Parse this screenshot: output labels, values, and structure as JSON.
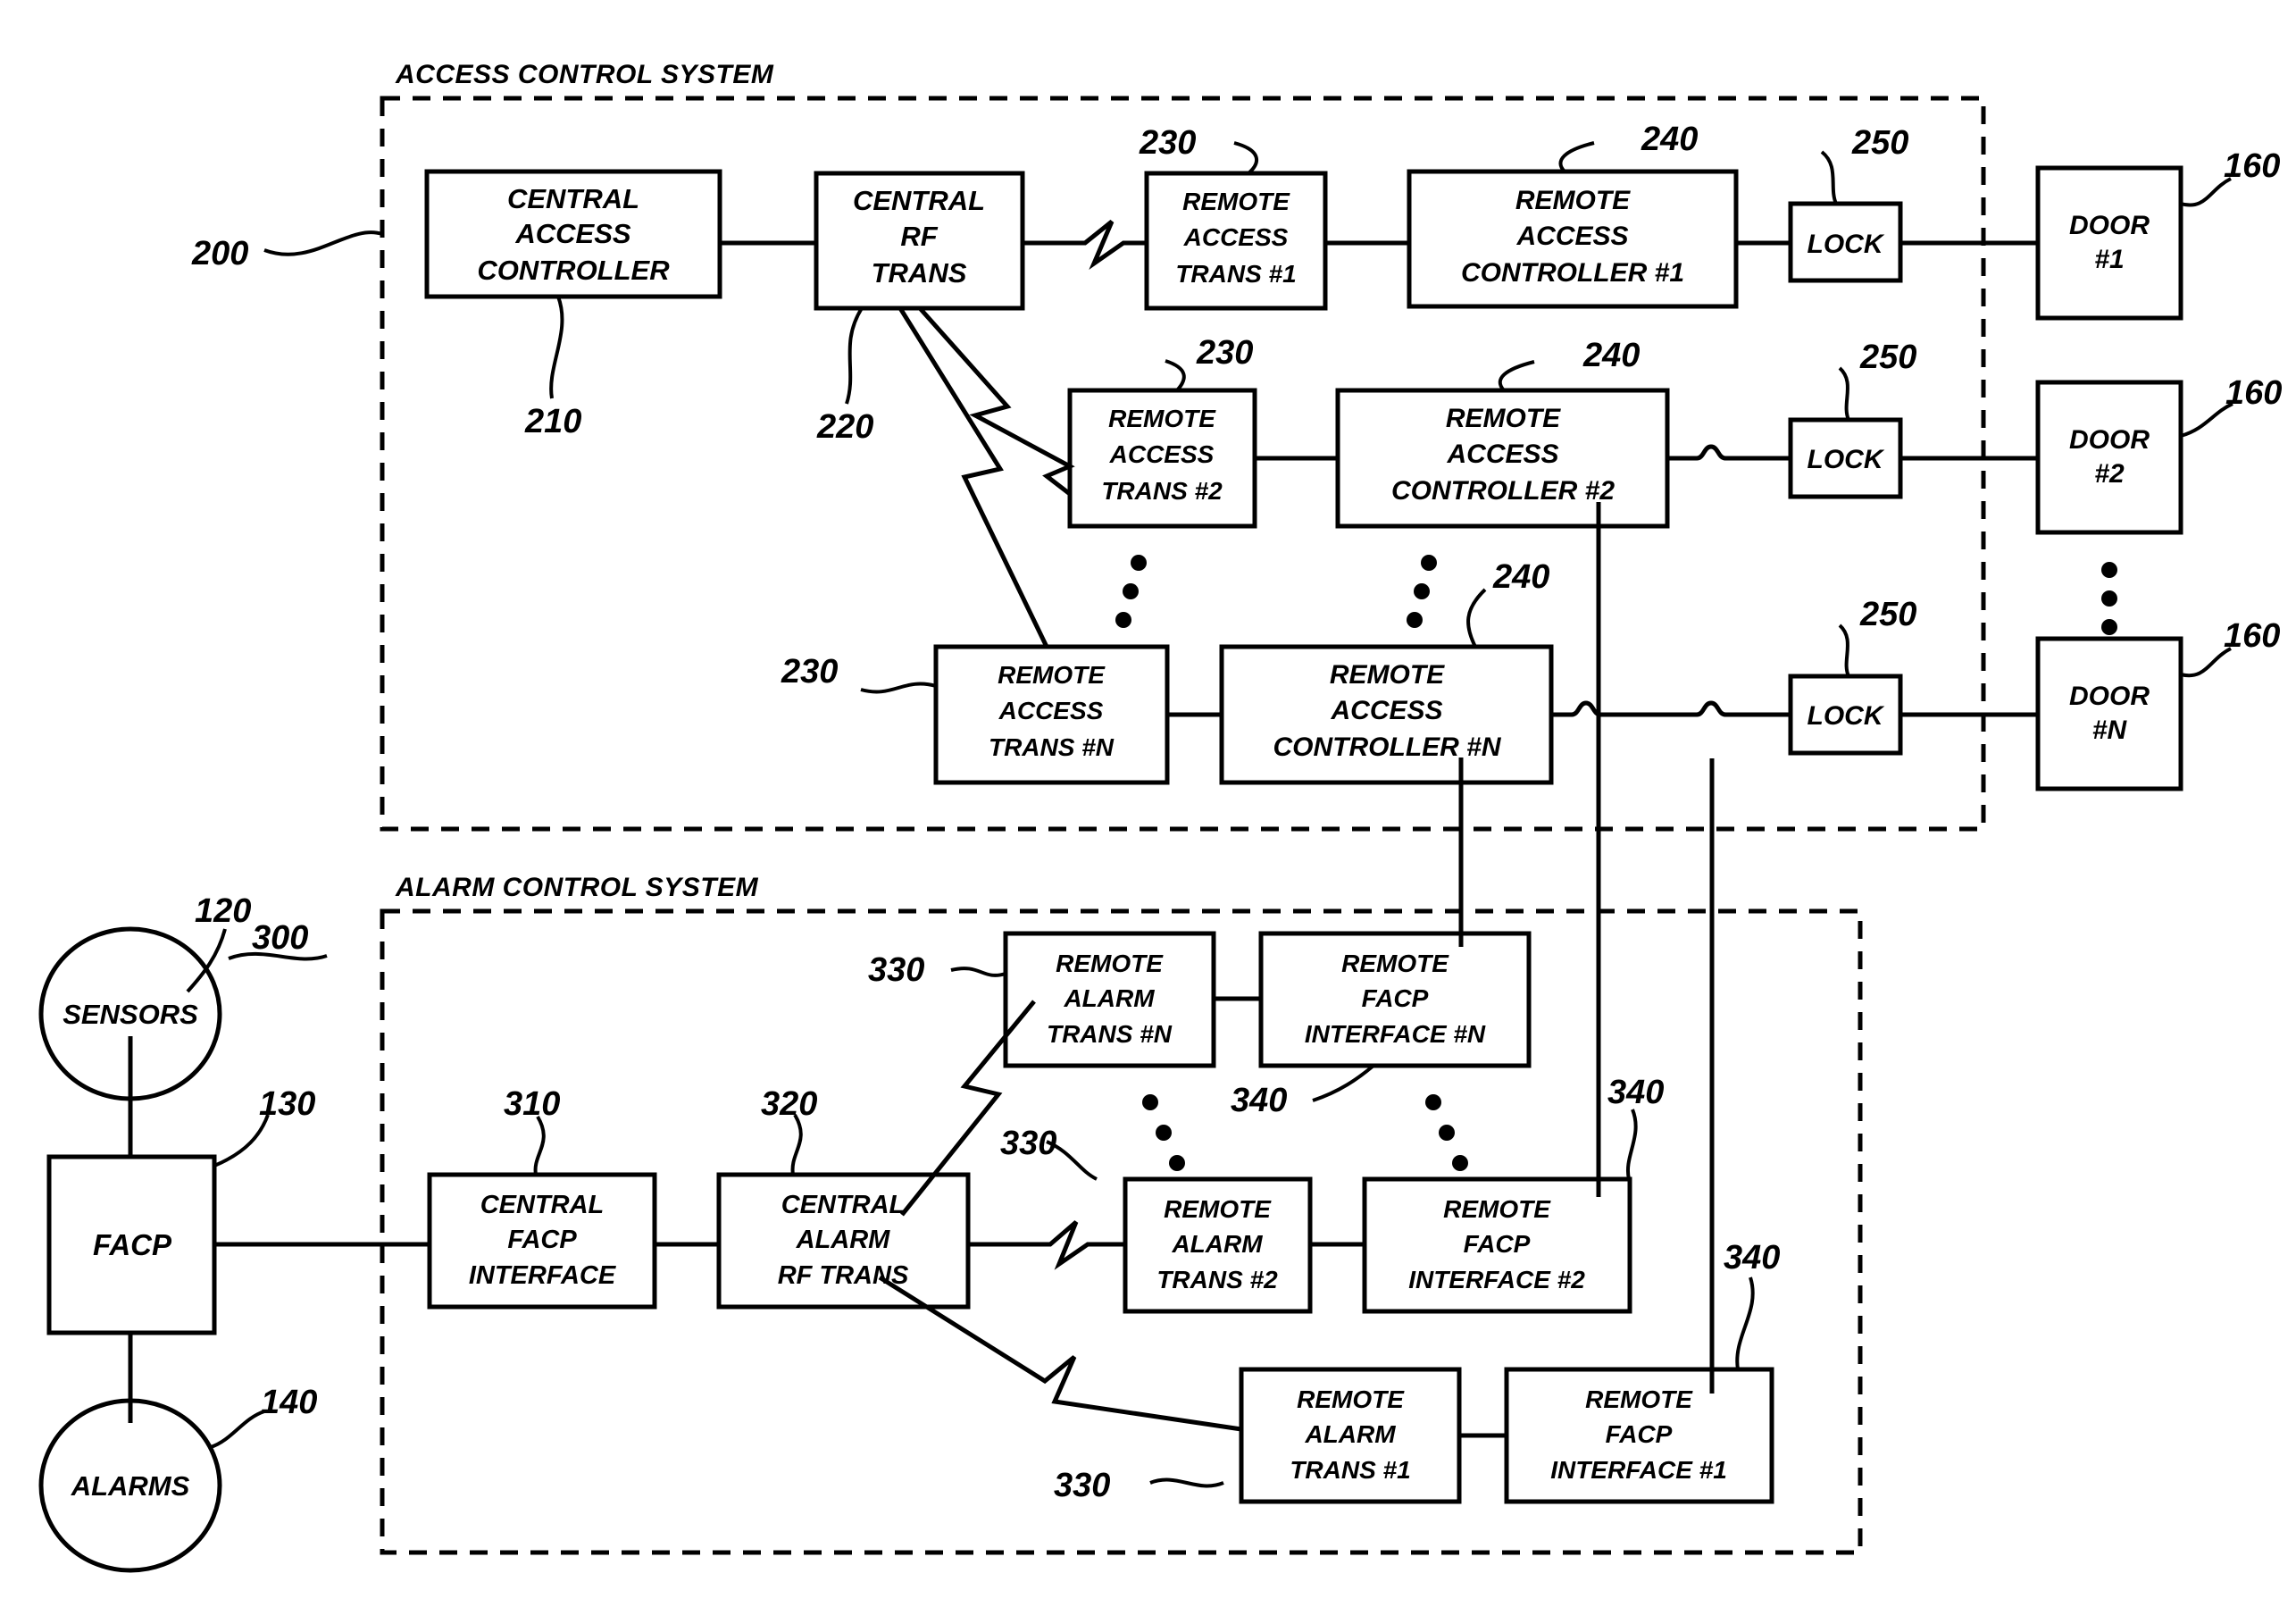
{
  "figure": {
    "access_system_title": "ACCESS CONTROL SYSTEM",
    "alarm_system_title": "ALARM CONTROL SYSTEM"
  },
  "refs": {
    "access_system": "200",
    "central_access_controller": "210",
    "central_rf_trans": "220",
    "remote_access_trans_1": "230",
    "remote_access_trans_2": "230",
    "remote_access_trans_n": "230",
    "remote_access_controller_1": "240",
    "remote_access_controller_2": "240",
    "remote_access_controller_n": "240",
    "lock_1": "250",
    "lock_2": "250",
    "lock_n": "250",
    "door_1": "160",
    "door_2": "160",
    "door_n": "160",
    "sensors": "120",
    "facp": "130",
    "alarms": "140",
    "alarm_system": "300",
    "central_facp_interface": "310",
    "central_alarm_rf_trans": "320",
    "remote_alarm_trans_n": "330",
    "remote_alarm_trans_2": "330",
    "remote_alarm_trans_1": "330",
    "remote_facp_interface_n": "340",
    "remote_facp_interface_2": "340",
    "remote_facp_interface_1": "340"
  },
  "access_system": {
    "central_access_controller": [
      "CENTRAL",
      "ACCESS",
      "CONTROLLER"
    ],
    "central_rf_trans": [
      "CENTRAL",
      "RF",
      "TRANS"
    ],
    "remote_access_trans": [
      [
        "REMOTE",
        "ACCESS",
        "TRANS #1"
      ],
      [
        "REMOTE",
        "ACCESS",
        "TRANS #2"
      ],
      [
        "REMOTE",
        "ACCESS",
        "TRANS #N"
      ]
    ],
    "remote_access_controller": [
      [
        "REMOTE",
        "ACCESS",
        "CONTROLLER #1"
      ],
      [
        "REMOTE",
        "ACCESS",
        "CONTROLLER #2"
      ],
      [
        "REMOTE",
        "ACCESS",
        "CONTROLLER #N"
      ]
    ],
    "locks": [
      "LOCK",
      "LOCK",
      "LOCK"
    ],
    "doors": [
      [
        "DOOR",
        "#1"
      ],
      [
        "DOOR",
        "#2"
      ],
      [
        "DOOR",
        "#N"
      ]
    ]
  },
  "alarm_system": {
    "sensors": "SENSORS",
    "facp": "FACP",
    "alarms": "ALARMS",
    "central_facp_interface": [
      "CENTRAL",
      "FACP",
      "INTERFACE"
    ],
    "central_alarm_rf_trans": [
      "CENTRAL",
      "ALARM",
      "RF TRANS"
    ],
    "remote_alarm_trans": [
      [
        "REMOTE",
        "ALARM",
        "TRANS #N"
      ],
      [
        "REMOTE",
        "ALARM",
        "TRANS #2"
      ],
      [
        "REMOTE",
        "ALARM",
        "TRANS #1"
      ]
    ],
    "remote_facp_interface": [
      [
        "REMOTE",
        "FACP",
        "INTERFACE #N"
      ],
      [
        "REMOTE",
        "FACP",
        "INTERFACE #2"
      ],
      [
        "REMOTE",
        "FACP",
        "INTERFACE #1"
      ]
    ]
  },
  "colors": {
    "ink": "#000000",
    "paper": "#ffffff"
  }
}
